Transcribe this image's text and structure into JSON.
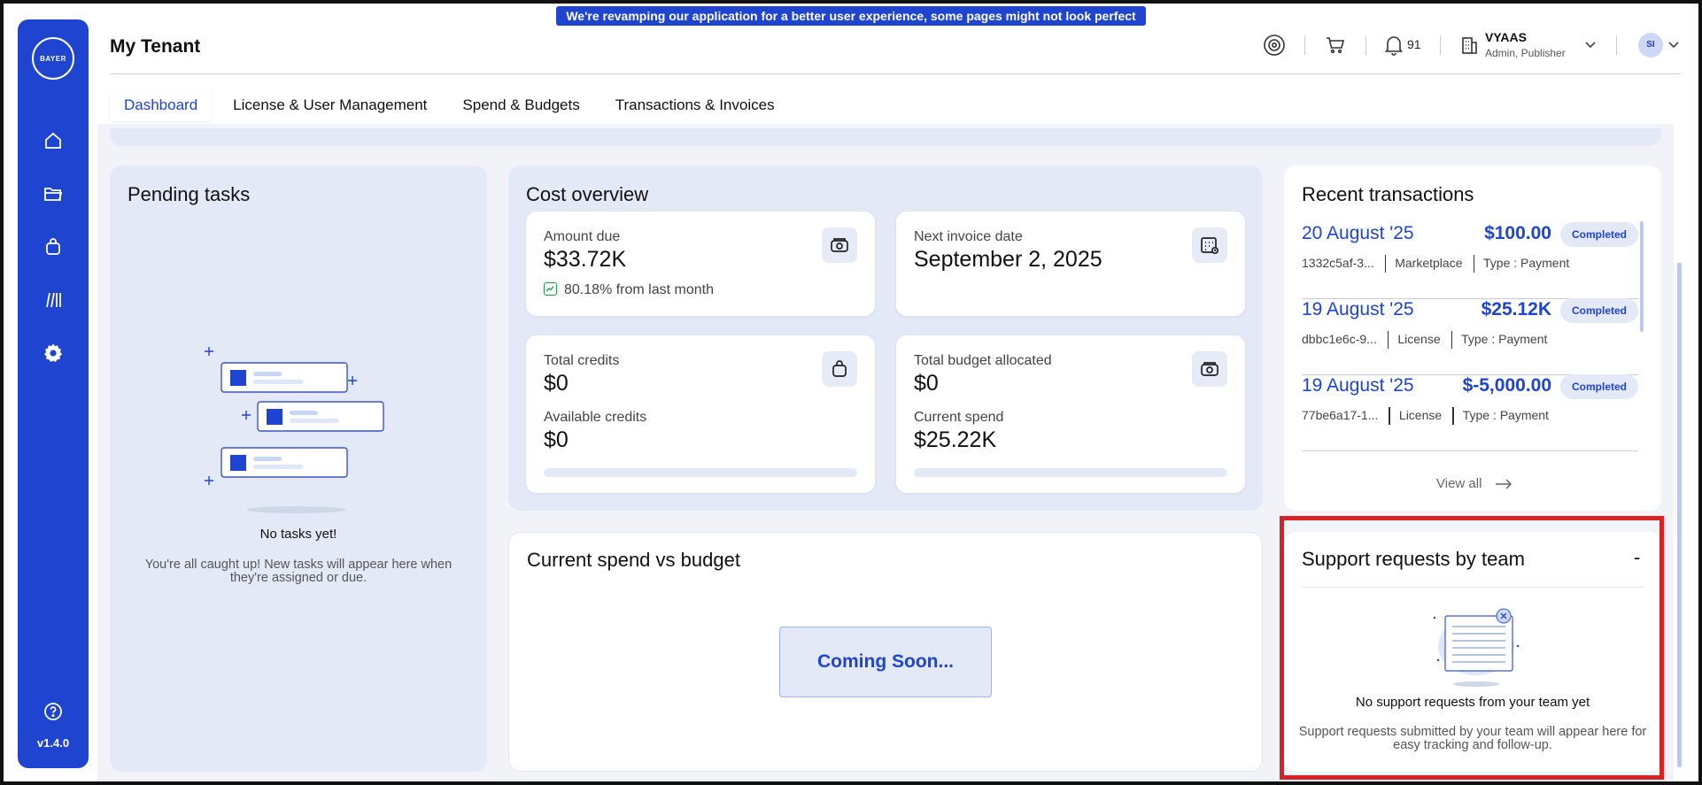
{
  "banner": "We're revamping our application for a better user experience, some pages might not look perfect yet!",
  "sidebar": {
    "logo_text_horizontal": "BAYER",
    "logo_text_vertical": "BAYER",
    "version": "v1.4.0",
    "items": [
      {
        "icon": "home-icon"
      },
      {
        "icon": "folder-icon"
      },
      {
        "icon": "bag-icon"
      },
      {
        "icon": "library-icon"
      },
      {
        "icon": "settings-icon"
      }
    ],
    "help_icon": "help-icon"
  },
  "header": {
    "title": "My Tenant",
    "notification_count": "91",
    "user_name": "VYAAS",
    "user_role": "Admin, Publisher",
    "avatar_initials": "SI"
  },
  "tabs": [
    {
      "label": "Dashboard",
      "active": true
    },
    {
      "label": "License & User Management",
      "active": false
    },
    {
      "label": "Spend & Budgets",
      "active": false
    },
    {
      "label": "Transactions & Invoices",
      "active": false
    }
  ],
  "pending": {
    "title": "Pending tasks",
    "empty_title": "No tasks yet!",
    "empty_desc": "You're all caught up! New tasks will appear here when they're assigned or due."
  },
  "cost": {
    "title": "Cost overview",
    "amount_due_label": "Amount due",
    "amount_due_value": "$33.72K",
    "trend_text": "80.18% from last month",
    "next_invoice_label": "Next invoice date",
    "next_invoice_value": "September 2, 2025",
    "total_credits_label": "Total credits",
    "total_credits_value": "$0",
    "available_credits_label": "Available credits",
    "available_credits_value": "$0",
    "credits_progress": 0,
    "total_budget_label": "Total budget allocated",
    "total_budget_value": "$0",
    "current_spend_label": "Current spend",
    "current_spend_value": "$25.22K",
    "budget_progress": 0
  },
  "spend": {
    "title": "Current spend vs budget",
    "coming_soon": "Coming Soon..."
  },
  "recent": {
    "title": "Recent transactions",
    "view_all": "View all",
    "transactions": [
      {
        "date": "20 August '25",
        "amount": "$100.00",
        "status": "Completed",
        "id": "1332c5af-3...",
        "category": "Marketplace",
        "type": "Type : Payment"
      },
      {
        "date": "19 August '25",
        "amount": "$25.12K",
        "status": "Completed",
        "id": "dbbc1e6c-9...",
        "category": "License",
        "type": "Type : Payment"
      },
      {
        "date": "19 August '25",
        "amount": "$-5,000.00",
        "status": "Completed",
        "id": "77be6a17-1...",
        "category": "License",
        "type": "Type : Payment"
      }
    ]
  },
  "support": {
    "title": "Support requests by team",
    "dash": "-",
    "empty_title": "No support requests from your team yet",
    "empty_desc": "Support requests submitted by your team will appear here for easy tracking and follow-up."
  }
}
